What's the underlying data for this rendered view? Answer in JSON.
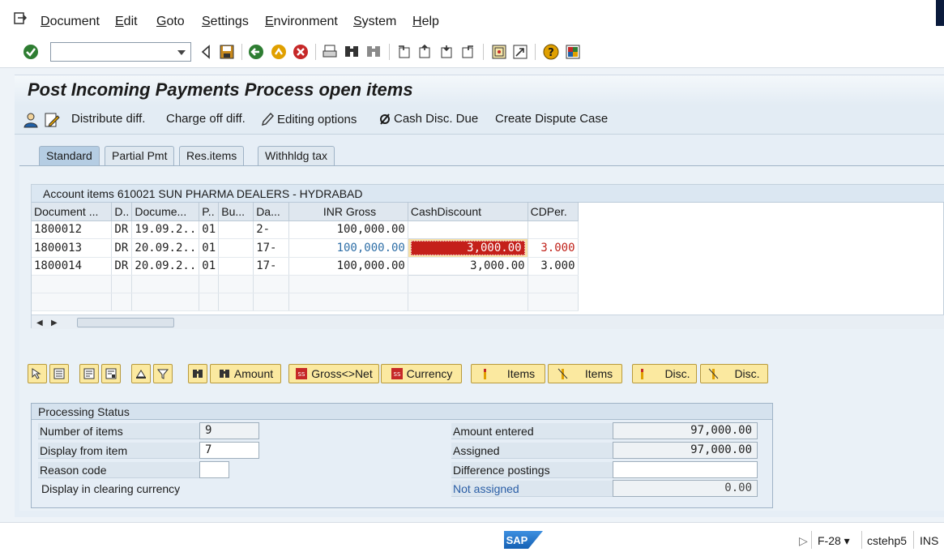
{
  "menu": {
    "items": [
      "Document",
      "Edit",
      "Goto",
      "Settings",
      "Environment",
      "System",
      "Help"
    ]
  },
  "toolbar": {
    "command_field": {
      "value": "",
      "placeholder": ""
    },
    "icons": [
      "enter-icon",
      "back-triangle-icon",
      "save-icon",
      "back-icon",
      "exit-icon",
      "cancel-icon",
      "print-icon",
      "find-icon",
      "find-next-icon",
      "first-page-icon",
      "prev-page-icon",
      "next-page-icon",
      "last-page-icon",
      "new-session-icon",
      "shortcut-icon",
      "help-icon",
      "customize-layout-icon"
    ]
  },
  "title": "Post Incoming Payments Process open items",
  "app_toolbar": {
    "distribute": "Distribute diff.",
    "charge_off": "Charge off diff.",
    "editing": "Editing options",
    "cash_disc_due": "Cash Disc. Due",
    "dispute": "Create Dispute Case"
  },
  "tabs": [
    "Standard",
    "Partial Pmt",
    "Res.items",
    "Withhldg tax"
  ],
  "active_tab": "Standard",
  "table": {
    "title": "Account items 610021 SUN PHARMA DEALERS - HYDRABAD",
    "columns": [
      "Document ...",
      "D..",
      "Docume...",
      "P..",
      "Bu...",
      "Da...",
      "INR Gross",
      "CashDiscount",
      "CDPer."
    ],
    "rows": [
      [
        "1800012",
        "DR",
        "19.09.2..",
        "01",
        "",
        "2-",
        "100,000.00",
        "",
        ""
      ],
      [
        "1800013",
        "DR",
        "20.09.2..",
        "01",
        "",
        "17-",
        "100,000.00",
        "3,000.00",
        "3.000"
      ],
      [
        "1800014",
        "DR",
        "20.09.2..",
        "01",
        "",
        "17-",
        "100,000.00",
        "3,000.00",
        "3.000"
      ]
    ]
  },
  "buttons": {
    "amount": "Amount",
    "gross_net": "Gross<>Net",
    "currency": "Currency",
    "items_activate": "Items",
    "items_deactivate": "Items",
    "disc_activate": "Disc.",
    "disc_deactivate": "Disc."
  },
  "processing": {
    "title": "Processing Status",
    "number_of_items_label": "Number of items",
    "number_of_items": "9",
    "display_from_label": "Display from item",
    "display_from": "7",
    "reason_code_label": "Reason code",
    "reason_code": "",
    "display_clearing_label": "Display in clearing currency",
    "amount_entered_label": "Amount entered",
    "amount_entered": "97,000.00",
    "assigned_label": "Assigned",
    "assigned": "97,000.00",
    "difference_label": "Difference postings",
    "difference": "",
    "not_assigned_label": "Not assigned",
    "not_assigned": "0.00"
  },
  "statusbar": {
    "logo": "SAP",
    "transaction": "F-28",
    "server": "cstehp5",
    "mode": "INS"
  },
  "colors": {
    "accent_blue": "#2f6fa7",
    "focus_red": "#c4201a",
    "button_yellow": "#fbe9a0"
  }
}
